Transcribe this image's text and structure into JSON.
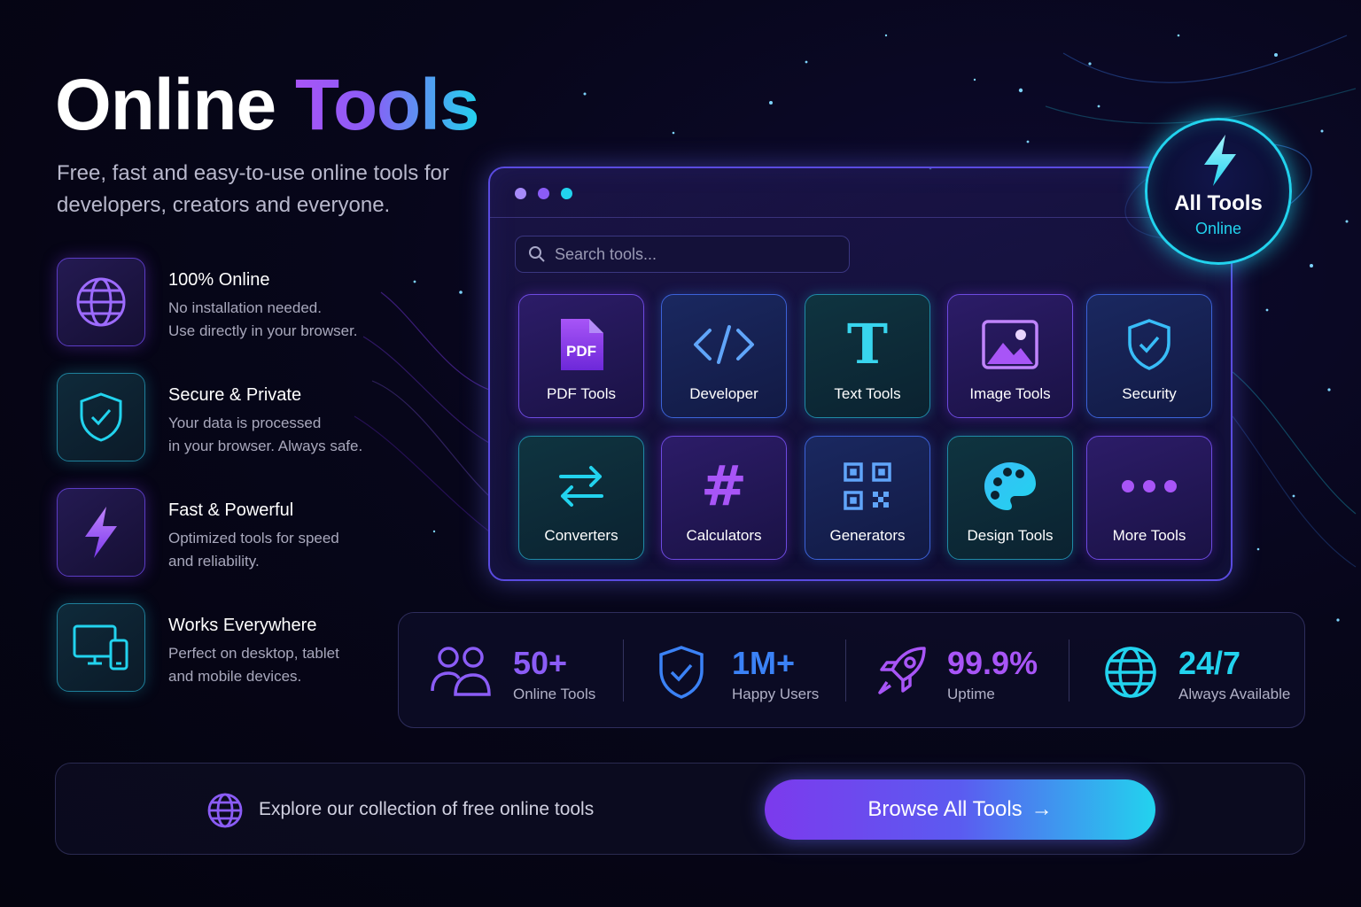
{
  "hero": {
    "title_word1": "Online",
    "title_word2": "Tools",
    "subtitle": "Free, fast and easy-to-use online tools for developers, creators and everyone."
  },
  "features": [
    {
      "icon": "globe-icon",
      "title": "100% Online",
      "desc_line1": "No installation needed.",
      "desc_line2": "Use directly in your browser."
    },
    {
      "icon": "shield-check-icon",
      "title": "Secure & Private",
      "desc_line1": "Your data is processed",
      "desc_line2": "in your browser. Always safe."
    },
    {
      "icon": "lightning-icon",
      "title": "Fast & Powerful",
      "desc_line1": "Optimized tools for speed",
      "desc_line2": "and reliability."
    },
    {
      "icon": "devices-icon",
      "title": "Works Everywhere",
      "desc_line1": "Perfect on desktop, tablet",
      "desc_line2": "and mobile devices."
    }
  ],
  "panel": {
    "search_placeholder": "Search tools...",
    "tiles": [
      {
        "label": "PDF Tools",
        "icon": "pdf-icon",
        "pdf_text": "PDF"
      },
      {
        "label": "Developer",
        "icon": "code-icon"
      },
      {
        "label": "Text Tools",
        "icon": "text-icon",
        "glyph": "T"
      },
      {
        "label": "Image Tools",
        "icon": "image-icon"
      },
      {
        "label": "Security",
        "icon": "shield-check-icon"
      },
      {
        "label": "Converters",
        "icon": "arrows-swap-icon"
      },
      {
        "label": "Calculators",
        "icon": "hash-icon",
        "glyph": "#"
      },
      {
        "label": "Generators",
        "icon": "qr-code-icon"
      },
      {
        "label": "Design Tools",
        "icon": "palette-icon"
      },
      {
        "label": "More Tools",
        "icon": "more-dots-icon"
      }
    ]
  },
  "badge": {
    "title": "All Tools",
    "subtitle": "Online",
    "icon": "lightning-icon"
  },
  "stats": [
    {
      "value": "50+",
      "label": "Online Tools",
      "icon": "users-icon"
    },
    {
      "value": "1M+",
      "label": "Happy Users",
      "icon": "shield-check-icon"
    },
    {
      "value": "99.9%",
      "label": "Uptime",
      "icon": "rocket-icon"
    },
    {
      "value": "24/7",
      "label": "Always Available",
      "icon": "globe-icon"
    }
  ],
  "cta": {
    "text": "Explore our collection of free online tools",
    "button_label": "Browse All Tools",
    "button_arrow": "→"
  },
  "colors": {
    "purple": "#8b5cf6",
    "violet": "#a855f7",
    "cyan": "#22d3ee",
    "blue": "#3b82f6",
    "background": "#07061a"
  }
}
